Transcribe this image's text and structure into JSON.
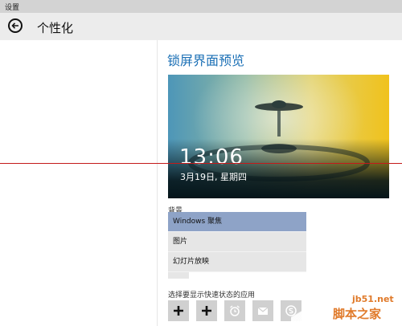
{
  "window": {
    "title": "设置"
  },
  "header": {
    "title": "个性化"
  },
  "lockscreen": {
    "section_title": "锁屏界面预览",
    "clock": "13:06",
    "date": "3月19日, 星期四"
  },
  "background": {
    "label": "背景",
    "options": [
      "Windows 聚焦",
      "图片",
      "幻灯片放映"
    ],
    "selected": "Windows 聚焦"
  },
  "quick_status": {
    "label": "选择要显示快速状态的应用",
    "apps": [
      "plus-icon",
      "plus-icon",
      "alarm-icon",
      "mail-icon",
      "skype-icon"
    ]
  },
  "watermark": {
    "site": "jb51.net",
    "name": "脚本之家"
  }
}
